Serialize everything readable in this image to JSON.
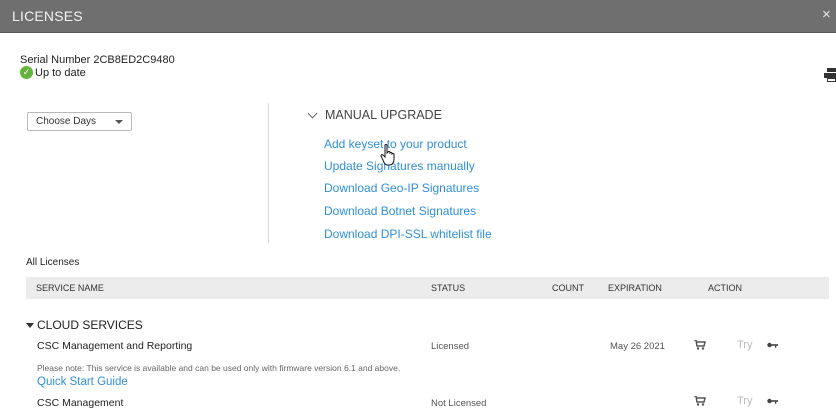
{
  "window": {
    "title": "LICENSES",
    "close_glyph": "×"
  },
  "device": {
    "serial": "Serial Number 2CB8ED2C9480",
    "status": "Up to date"
  },
  "filter": {
    "selected": "Choose Days"
  },
  "manual_upgrade": {
    "header": "MANUAL UPGRADE",
    "links": [
      "Add keyset to your product",
      "Update Signatures manually",
      "Download Geo-IP Signatures",
      "Download Botnet Signatures",
      "Download DPI-SSL whitelist file"
    ]
  },
  "licenses": {
    "section_label": "All Licenses",
    "columns": [
      "SERVICE NAME",
      "STATUS",
      "COUNT",
      "EXPIRATION",
      "ACTION"
    ],
    "group": "CLOUD SERVICES",
    "rows": [
      {
        "name": "CSC Management and Reporting",
        "status": "Licensed",
        "expiration": "May 26 2021",
        "note": "Please note: This service is available and can be used only with firmware version 6.1 and above.",
        "note_link": "Quick Start Guide",
        "try": "Try"
      },
      {
        "name": "CSC Management",
        "status": "Not Licensed",
        "expiration": "",
        "try": "Try"
      }
    ]
  },
  "icons": [
    "check-icon",
    "print-icon",
    "chevron-down-icon",
    "caret-down-icon",
    "cart-icon",
    "key-icon",
    "hand-cursor-icon",
    "close-icon"
  ],
  "colors": {
    "titlebar": "#6f6f6f",
    "link": "#2f8fd8",
    "ok": "#63b33d",
    "header_row": "#ececec"
  }
}
